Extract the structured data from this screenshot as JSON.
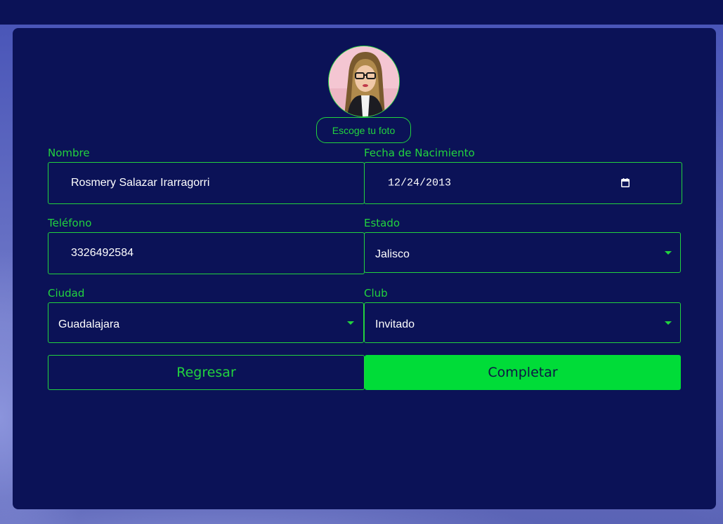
{
  "profile": {
    "photo_button": "Escoge tu foto"
  },
  "form": {
    "nombre": {
      "label": "Nombre",
      "value": "Rosmery Salazar Irarragorri"
    },
    "fecha": {
      "label": "Fecha de Nacimiento",
      "value": "12/24/2013"
    },
    "telefono": {
      "label": "Teléfono",
      "value": "3326492584"
    },
    "estado": {
      "label": "Estado",
      "value": "Jalisco"
    },
    "ciudad": {
      "label": "Ciudad",
      "value": "Guadalajara"
    },
    "club": {
      "label": "Club",
      "value": "Invitado"
    }
  },
  "actions": {
    "back": "Regresar",
    "complete": "Completar"
  },
  "icons": {
    "avatar": "profile-photo",
    "calendar": "calendar-icon",
    "dropdown": "chevron-down-icon"
  },
  "colors": {
    "background": "#0b1257",
    "accent": "#22d33e",
    "primary_button": "#00dc38",
    "text": "#ffffff"
  }
}
